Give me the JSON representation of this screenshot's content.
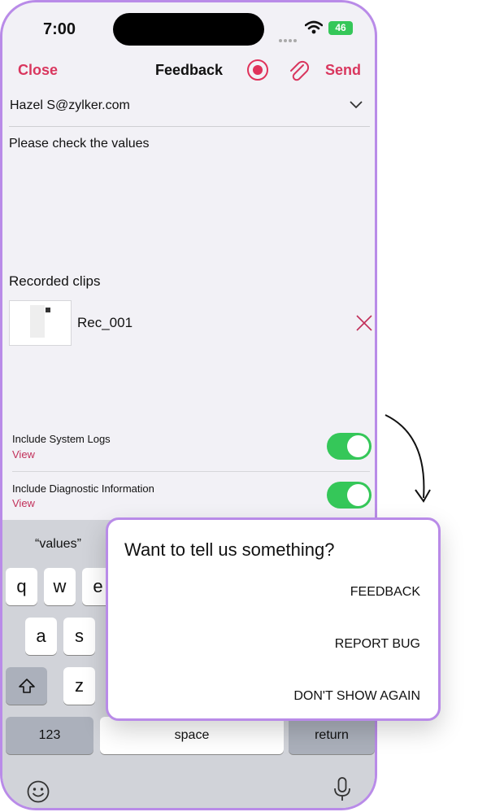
{
  "status_bar": {
    "time": "7:00",
    "battery": "46"
  },
  "nav": {
    "close_label": "Close",
    "title": "Feedback",
    "send_label": "Send"
  },
  "compose": {
    "from": "Hazel S@zylker.com",
    "message": "Please check the values",
    "recorded_clips_heading": "Recorded clips",
    "clip_name": "Rec_001"
  },
  "options": [
    {
      "label": "Include System Logs",
      "link": "View",
      "enabled": true
    },
    {
      "label": "Include Diagnostic Information",
      "link": "View",
      "enabled": true
    }
  ],
  "keyboard": {
    "suggestion": "“values”",
    "keys_row1": [
      "q",
      "w",
      "e"
    ],
    "keys_row2": [
      "a",
      "s"
    ],
    "keys_row3": [
      "z"
    ],
    "numbers_label": "123",
    "space_label": "space",
    "return_label": "return"
  },
  "popup": {
    "title": "Want to tell us something?",
    "feedback_label": "FEEDBACK",
    "report_bug_label": "REPORT BUG",
    "dont_show_label": "DON'T SHOW AGAIN"
  },
  "colors": {
    "accent": "#d9365e",
    "toggle_on": "#35c759",
    "frame": "#b98be8"
  }
}
